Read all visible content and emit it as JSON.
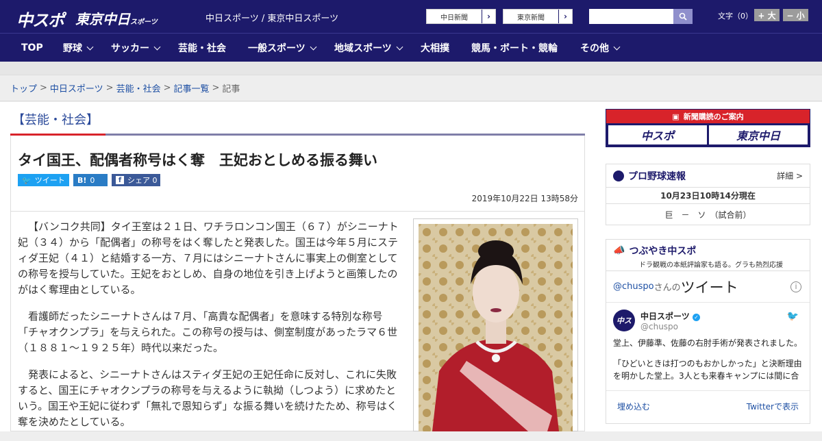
{
  "header": {
    "logo_chuspo": "中スポ",
    "logo_tokyo": "東京中日",
    "logo_tokyo_sub": "スポーツ",
    "site_name": "中日スポーツ / 東京中日スポーツ",
    "btn_chunichi": "中日新聞",
    "btn_tokyo": "東京新聞",
    "search_placeholder": "",
    "font_label": "文字（0）",
    "font_up": "+ 大",
    "font_down": "− 小"
  },
  "nav": [
    {
      "label": "TOP"
    },
    {
      "label": "野球"
    },
    {
      "label": "サッカー"
    },
    {
      "label": "芸能・社会"
    },
    {
      "label": "一般スポーツ"
    },
    {
      "label": "地域スポーツ"
    },
    {
      "label": "大相撲"
    },
    {
      "label": "競馬・ボート・競輪"
    },
    {
      "label": "その他"
    }
  ],
  "breadcrumb": [
    "トップ",
    "中日スポーツ",
    "芸能・社会",
    "記事一覧",
    "記事"
  ],
  "article": {
    "category": "【芸能・社会】",
    "headline": "タイ国王、配偶者称号はく奪　王妃おとしめる振る舞い",
    "share_tweet": "ツイート",
    "share_hatena_count": "0",
    "share_fb": "シェア",
    "share_fb_count": "0",
    "date": "2019年10月22日 13時58分",
    "paragraphs": [
      "【バンコク共同】タイ王室は２１日、ワチラロンコン国王（６７）がシニーナト妃（３４）から「配偶者」の称号をはく奪したと発表した。国王は今年５月にスティダ王妃（４１）と結婚する一方、７月にはシニーナトさんに事実上の側室としての称号を授与していた。王妃をおとしめ、自身の地位を引き上げようと画策したのがはく奪理由としている。",
      "看護師だったシニーナトさんは７月、「高貴な配偶者」を意味する特別な称号「チャオクンプラ」を与えられた。この称号の授与は、側室制度があったラマ６世（１８８１～１９２５年）時代以来だった。",
      "発表によると、シニーナトさんはスティダ王妃の王妃任命に反対し、これに失敗すると、国王にチャオクンプラの称号を与えるように執拗（しつよう）に求めたという。国王や王妃に従わず「無礼で恩知らず」な振る舞いを続けたため、称号はく奪を決めたとしている。"
    ]
  },
  "sidebar": {
    "subscribe_title": "新聞購読のご案内",
    "subscribe_logo1": "中スポ",
    "subscribe_logo2": "東京中日",
    "baseball_title": "プロ野球速報",
    "baseball_more": "詳細 >",
    "baseball_time": "10月23日10時14分現在",
    "baseball_game": "巨　－　ソ　（試合前）",
    "tsubuyaki_title": "つぶやき中スポ",
    "tsubuyaki_sub": "ドラ観戦の本紙評論家も語る。グラも熱烈応援",
    "tweet_account_link": "@chuspo",
    "tweet_account_suffix": "さんの",
    "tweet_heading": "ツイート",
    "tweet_user": "中日スポーツ",
    "tweet_handle": "@chuspo",
    "tweet_text1": "堂上、伊藤準、佐藤の右肘手術が発表されました。",
    "tweet_text2": "「ひどいときは打つのもおかしかった」と決断理由を明かした堂上。3人とも来春キャンプには間に合",
    "embed_label": "埋め込む",
    "view_on_twitter": "Twitterで表示"
  }
}
